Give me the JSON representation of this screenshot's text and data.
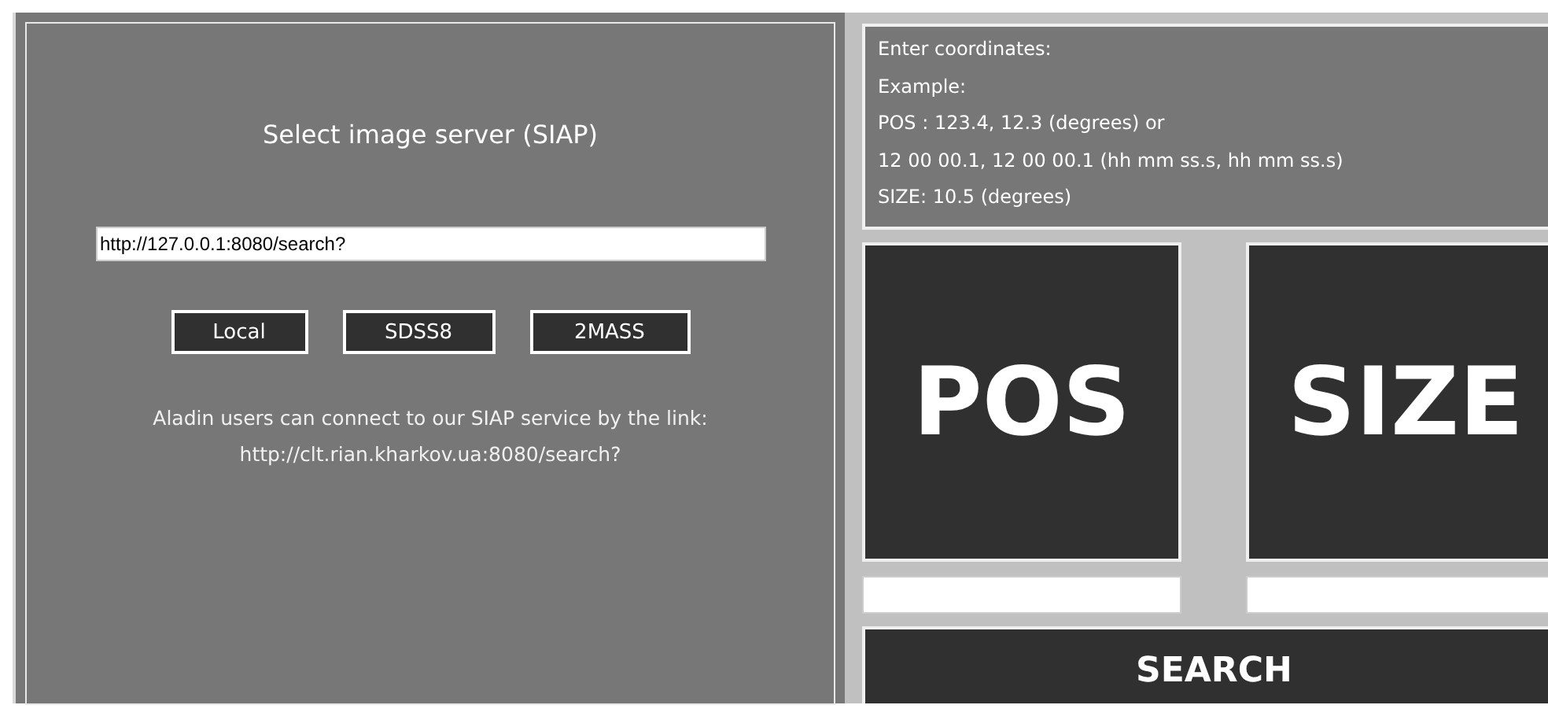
{
  "server_panel": {
    "title": "Select image server (SIAP)",
    "url_field": {
      "value": "http://127.0.0.1:8080/search?"
    },
    "buttons": [
      {
        "label": "Local"
      },
      {
        "label": "SDSS8"
      },
      {
        "label": "2MASS"
      }
    ],
    "note_lines": [
      "Aladin users can connect to our SIAP service by the link:",
      "http://clt.rian.kharkov.ua:8080/search?"
    ]
  },
  "search_panel": {
    "instructions": [
      "Enter coordinates:",
      "Example:",
      "POS : 123.4, 12.3 (degrees) or",
      "12 00 00.1, 12 00 00.1 (hh mm ss.s, hh mm ss.s)",
      "SIZE: 10.5 (degrees)"
    ],
    "tiles": [
      {
        "label": "POS"
      },
      {
        "label": "SIZE"
      }
    ],
    "search_button": {
      "label": "SEARCH"
    }
  }
}
